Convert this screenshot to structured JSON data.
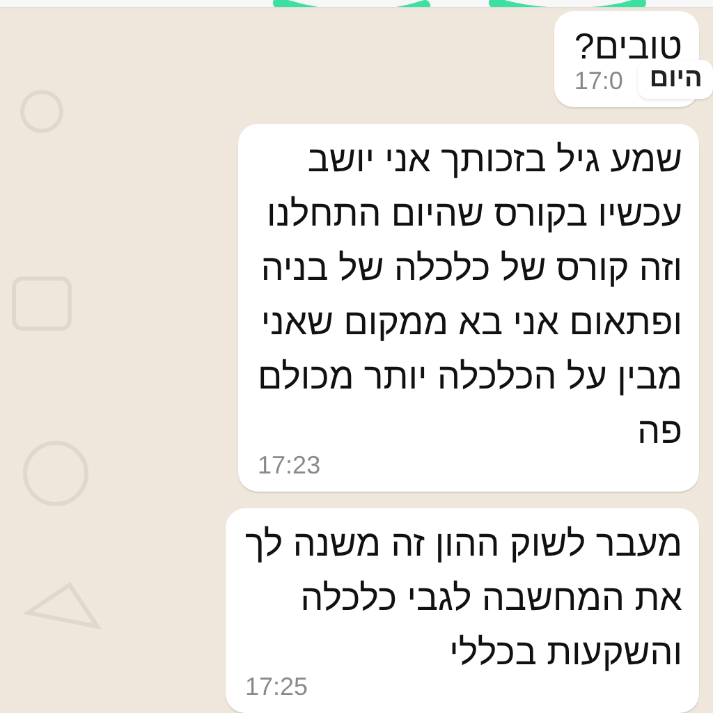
{
  "date_chip": "היום",
  "messages": [
    {
      "text": "טובים?",
      "time": "17:0"
    },
    {
      "text": "שמע גיל בזכותך אני יושב\nעכשיו בקורס שהיום התחלנו\nוזה קורס של כלכלה של בניה\nופתאום אני בא ממקום שאני\nמבין על הכלכלה יותר מכולם\nפה",
      "time": "17:23"
    },
    {
      "text": "מעבר לשוק ההון זה משנה לך\nאת המחשבה לגבי כלכלה\nוהשקעות בכללי",
      "time": "17:25"
    }
  ]
}
